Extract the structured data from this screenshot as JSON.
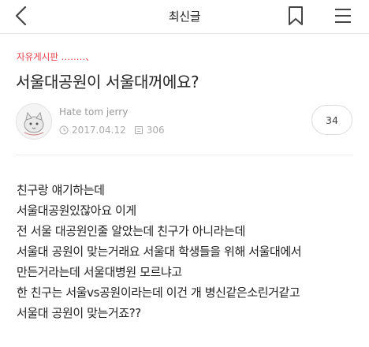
{
  "header": {
    "title": "최신글",
    "back_icon": "chevron-left-icon",
    "bookmark_icon": "bookmark-icon",
    "menu_icon": "hamburger-menu-icon"
  },
  "post": {
    "board": "자유게시판 ‥‥‥‥、",
    "title": "서울대공원이 서울대꺼에요?",
    "author": "Hate tom jerry",
    "date": "2017.04.12",
    "views": "306",
    "comment_count": "34",
    "body_lines": [
      "친구랑 얘기하는데",
      "서울대공원있잖아요 이게",
      "전 서울 대공원인줄 알았는데 친구가 아니라는데",
      "서울대 공원이 맞는거래요 서울대 학생들을 위해 서울대에서",
      "만든거라는데 서울대병원 모르냐고",
      "한 친구는 서울vs공원이라는데 이건 개 병신같은소린거같고",
      "서울대 공원이 맞는거죠??"
    ]
  },
  "colors": {
    "accent": "#e8404a",
    "text": "#222222",
    "meta": "#aaaaaa",
    "border": "#dcdcdc"
  }
}
